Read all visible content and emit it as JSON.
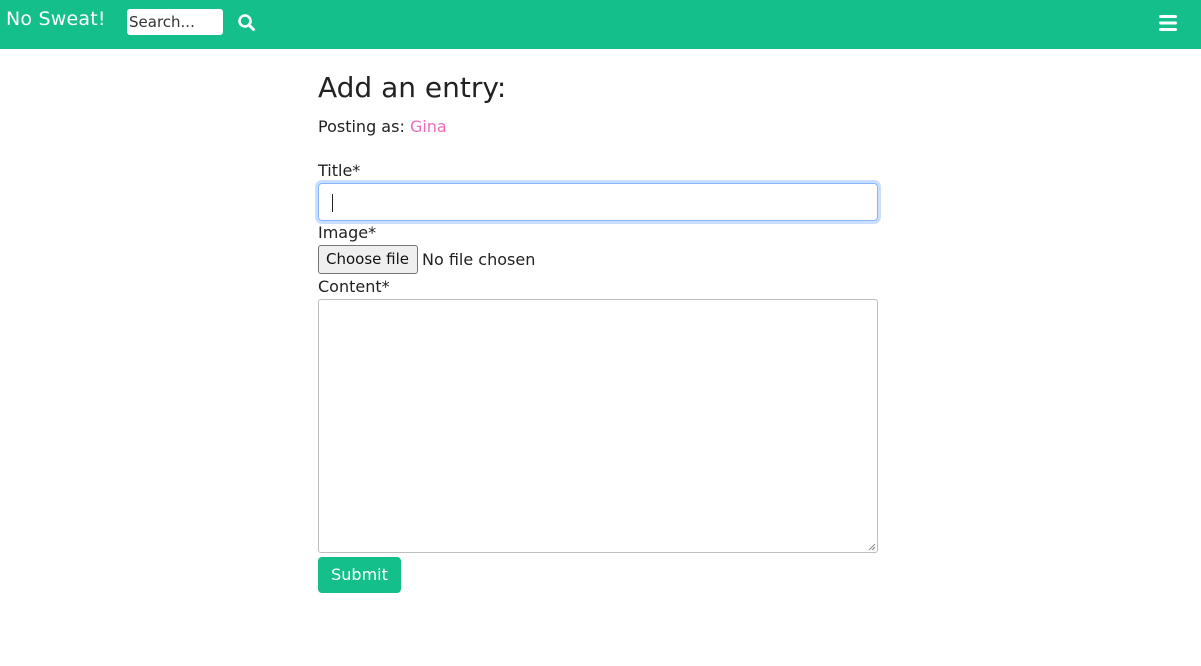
{
  "navbar": {
    "brand": "No Sweat!",
    "search_placeholder": "Search...",
    "search_icon": "search-icon",
    "menu_icon": "hamburger-menu-icon",
    "background_color": "#14bf8c"
  },
  "form": {
    "heading": "Add an entry:",
    "posting_as_label": "Posting as:",
    "posting_as_user": "Gina",
    "user_color": "#ee6bbb",
    "title_label": "Title*",
    "title_value": "",
    "image_label": "Image*",
    "file_button_label": "Choose file",
    "file_status": "No file chosen",
    "content_label": "Content*",
    "content_value": "",
    "submit_label": "Submit"
  }
}
